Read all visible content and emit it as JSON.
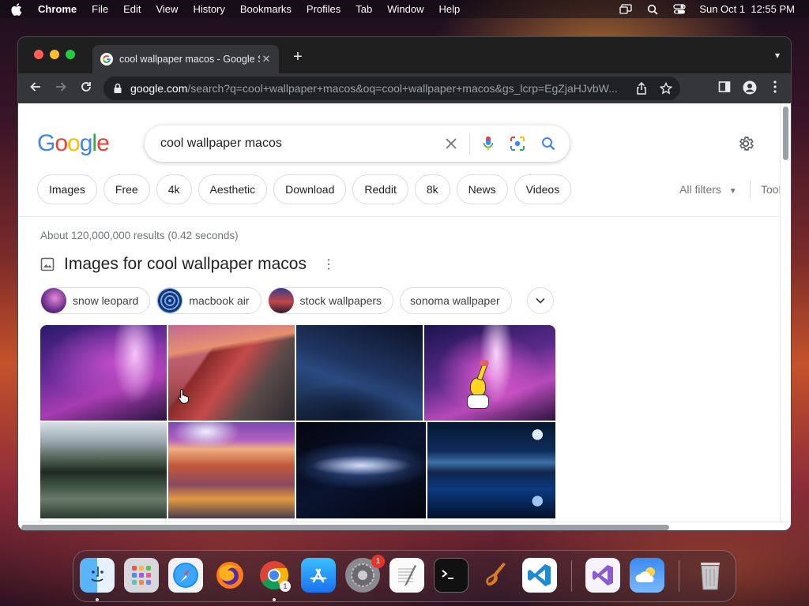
{
  "menubar": {
    "app": "Chrome",
    "items": [
      "File",
      "Edit",
      "View",
      "History",
      "Bookmarks",
      "Profiles",
      "Tab",
      "Window",
      "Help"
    ],
    "clock": "Sun Oct 1  12:55 PM"
  },
  "browser": {
    "tab_title": "cool wallpaper macos - Google Search",
    "url_host": "google.com",
    "url_rest": "/search?q=cool+wallpaper+macos&oq=cool+wallpaper+macos&gs_lcrp=EgZjaHJvbW..."
  },
  "google": {
    "logo_letters": [
      "G",
      "o",
      "o",
      "g",
      "l",
      "e"
    ],
    "logo_colors": [
      "#4285F4",
      "#EA4335",
      "#FBBC05",
      "#4285F4",
      "#34A853",
      "#EA4335"
    ],
    "query": "cool wallpaper macos",
    "chips": [
      "Images",
      "Free",
      "4k",
      "Aesthetic",
      "Download",
      "Reddit",
      "8k",
      "News",
      "Videos"
    ],
    "all_filters": "All filters",
    "tools": "Tools",
    "result_stats": "About 120,000,000 results (0.42 seconds)",
    "images_heading": "Images for cool wallpaper macos",
    "related": [
      "snow leopard",
      "macbook air",
      "stock wallpapers",
      "sonoma wallpaper"
    ]
  },
  "dock": {
    "apps": [
      "finder",
      "launchpad",
      "safari",
      "firefox",
      "chrome",
      "app-store",
      "system-settings",
      "textedit",
      "terminal",
      "garageband",
      "vscode",
      "visual-studio",
      "weather",
      "trash"
    ],
    "settings_badge": "1",
    "chrome_badge": "1"
  },
  "colors": {
    "accent": "#1a73e8",
    "window_bg": "#202124",
    "toolbar": "#35363a"
  }
}
